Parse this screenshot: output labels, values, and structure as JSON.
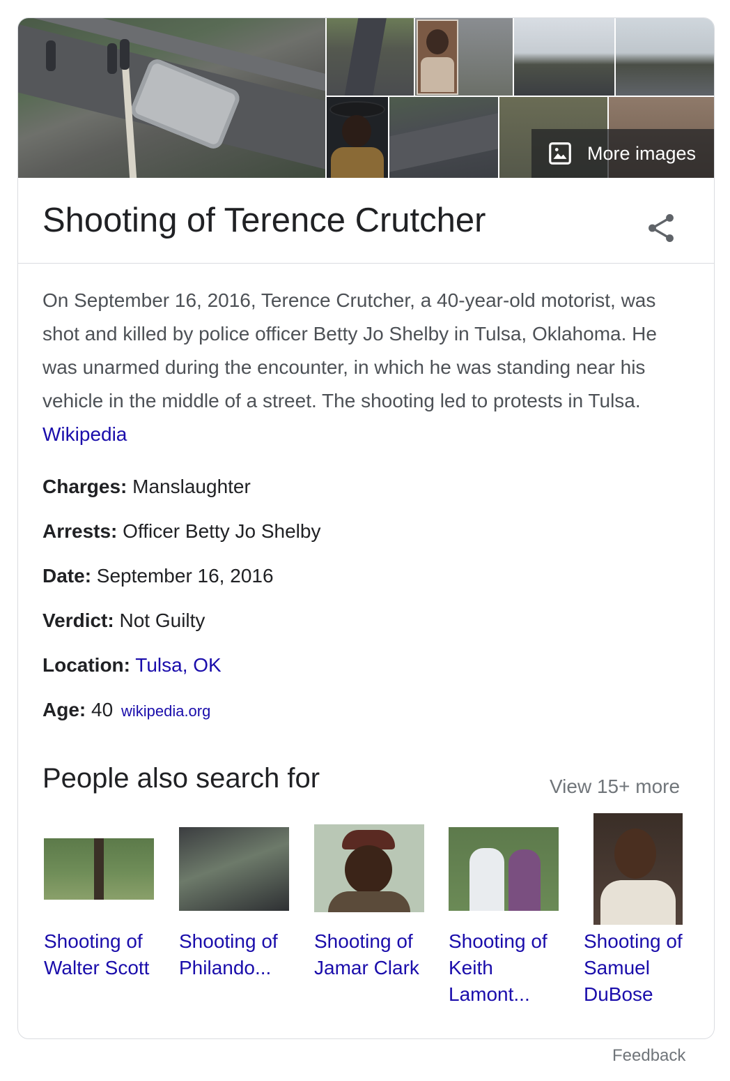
{
  "mosaic": {
    "more_images_label": "More images"
  },
  "entity": {
    "title": "Shooting of Terence Crutcher",
    "description": "On September 16, 2016, Terence Crutcher, a 40-year-old motorist, was shot and killed by police officer Betty Jo Shelby in Tulsa, Oklahoma. He was unarmed during the encounter, in which he was standing near his vehicle in the middle of a street. The shooting led to protests in Tulsa.",
    "source_link": "Wikipedia"
  },
  "facts": [
    {
      "label": "Charges:",
      "value": "Manslaughter"
    },
    {
      "label": "Arrests:",
      "value": "Officer Betty Jo Shelby"
    },
    {
      "label": "Date:",
      "value": "September 16, 2016"
    },
    {
      "label": "Verdict:",
      "value": "Not Guilty"
    },
    {
      "label": "Location:",
      "value": "Tulsa, OK"
    },
    {
      "label": "Age:",
      "value": "40",
      "source": "wikipedia.org"
    }
  ],
  "pasf": {
    "title": "People also search for",
    "view_more": "View 15+ more",
    "items": [
      {
        "label": "Shooting of Walter Scott"
      },
      {
        "label": "Shooting of Philando..."
      },
      {
        "label": "Shooting of Jamar Clark"
      },
      {
        "label": "Shooting of Keith Lamont..."
      },
      {
        "label": "Shooting of Samuel DuBose"
      }
    ]
  },
  "footer": {
    "feedback": "Feedback"
  }
}
